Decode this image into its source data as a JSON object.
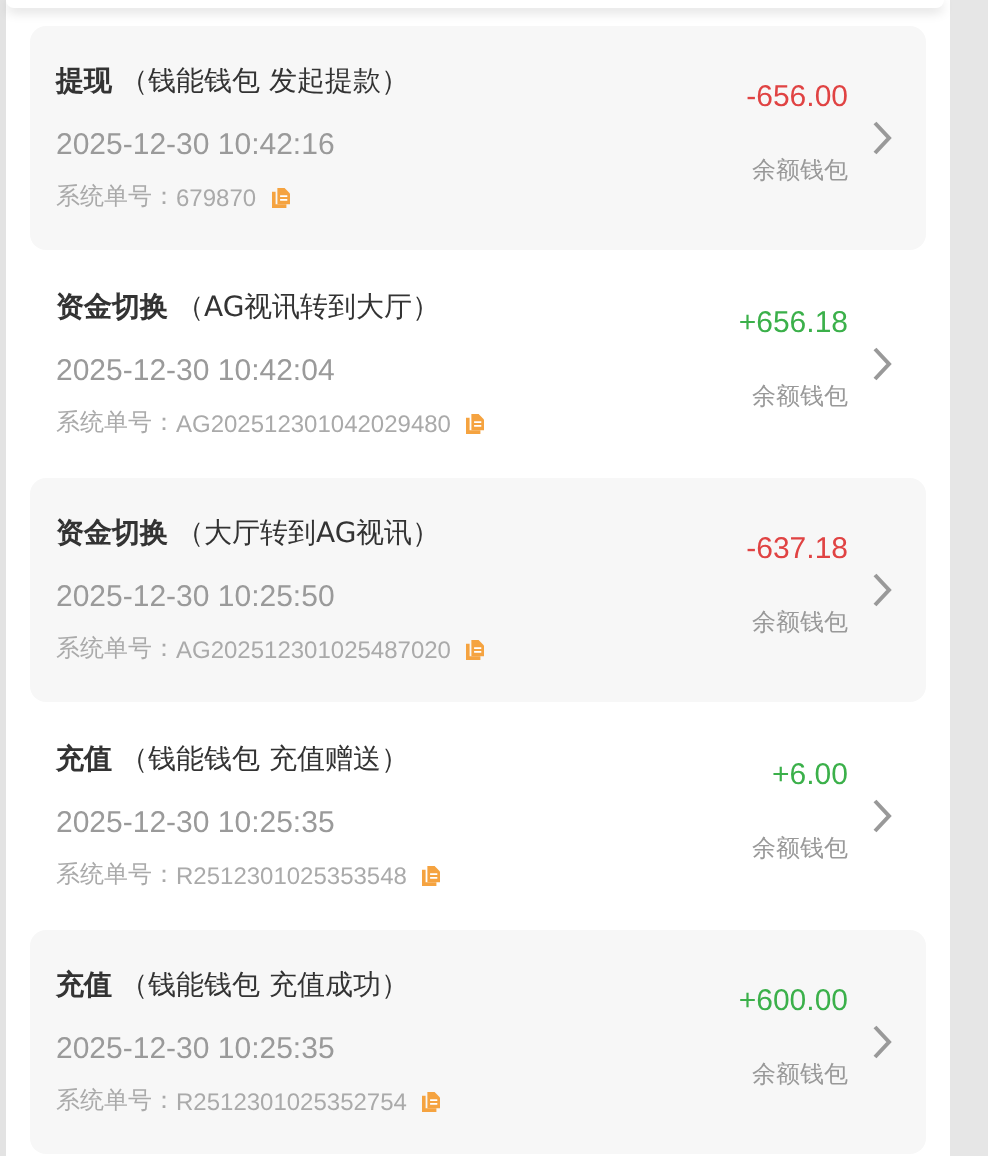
{
  "records": [
    {
      "title": "提现",
      "note": "（钱能钱包 发起提款）",
      "time": "2025-12-30 10:42:16",
      "order_label": "系统单号：",
      "order_no": "679870",
      "amount": "-656.00",
      "kind": "debit",
      "wallet": "余额钱包"
    },
    {
      "title": "资金切换",
      "note": "（AG视讯转到大厅）",
      "time": "2025-12-30 10:42:04",
      "order_label": "系统单号：",
      "order_no": "AG202512301042029480",
      "amount": "+656.18",
      "kind": "credit",
      "wallet": "余额钱包"
    },
    {
      "title": "资金切换",
      "note": "（大厅转到AG视讯）",
      "time": "2025-12-30 10:25:50",
      "order_label": "系统单号：",
      "order_no": "AG202512301025487020",
      "amount": "-637.18",
      "kind": "debit",
      "wallet": "余额钱包"
    },
    {
      "title": "充值",
      "note": "（钱能钱包 充值赠送）",
      "time": "2025-12-30 10:25:35",
      "order_label": "系统单号：",
      "order_no": "R2512301025353548",
      "amount": "+6.00",
      "kind": "credit",
      "wallet": "余额钱包"
    },
    {
      "title": "充值",
      "note": "（钱能钱包 充值成功）",
      "time": "2025-12-30 10:25:35",
      "order_label": "系统单号：",
      "order_no": "R2512301025352754",
      "amount": "+600.00",
      "kind": "credit",
      "wallet": "余额钱包"
    }
  ]
}
